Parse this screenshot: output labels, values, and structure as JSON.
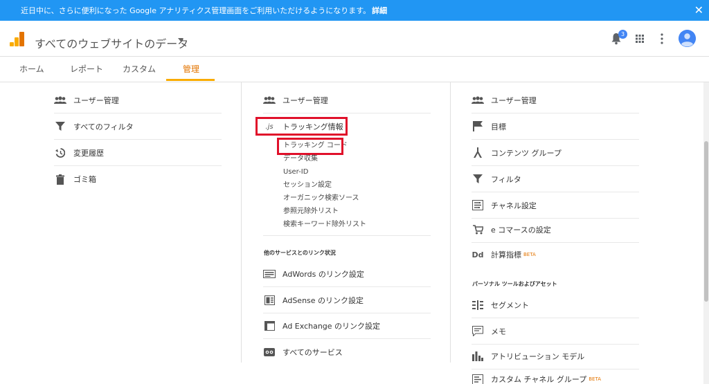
{
  "banner": {
    "text": "近日中に、さらに便利になった Google アナリティクス管理画面をご利用いただけるようになります。",
    "link": "詳細",
    "close": "✕"
  },
  "header": {
    "property_name": "すべてのウェブサイトのデータ",
    "notification_count": "3"
  },
  "tabs": [
    {
      "label": "ホーム"
    },
    {
      "label": "レポート"
    },
    {
      "label": "カスタム"
    },
    {
      "label": "管理"
    }
  ],
  "account_column": {
    "items": [
      {
        "label": "ユーザー管理",
        "icon": "users-icon"
      },
      {
        "label": "すべてのフィルタ",
        "icon": "filter-icon"
      },
      {
        "label": "変更履歴",
        "icon": "history-icon"
      },
      {
        "label": "ゴミ箱",
        "icon": "trash-icon"
      }
    ]
  },
  "property_column": {
    "user_mgmt": "ユーザー管理",
    "tracking_info": "トラッキング情報",
    "tracking_icon_text": ".js",
    "tracking_sub": [
      "トラッキング コード",
      "データ収集",
      "User-ID",
      "セッション設定",
      "オーガニック検索ソース",
      "参照元除外リスト",
      "検索キーワード除外リスト"
    ],
    "section_label": "他のサービスとのリンク状況",
    "links": [
      {
        "label": "AdWords のリンク設定",
        "icon": "adwords-icon"
      },
      {
        "label": "AdSense のリンク設定",
        "icon": "adsense-icon"
      },
      {
        "label": "Ad Exchange のリンク設定",
        "icon": "adexchange-icon"
      },
      {
        "label": "すべてのサービス",
        "icon": "link-icon"
      }
    ]
  },
  "view_column": {
    "items": [
      {
        "label": "ユーザー管理",
        "icon": "users-icon"
      },
      {
        "label": "目標",
        "icon": "flag-icon"
      },
      {
        "label": "コンテンツ グループ",
        "icon": "content-group-icon"
      },
      {
        "label": "フィルタ",
        "icon": "filter-icon"
      },
      {
        "label": "チャネル設定",
        "icon": "channel-icon"
      },
      {
        "label": "e コマースの設定",
        "icon": "cart-icon"
      },
      {
        "label": "計算指標",
        "icon": "dd-icon",
        "beta": "BETA"
      }
    ],
    "section_label": "パーソナル ツールおよびアセット",
    "tools": [
      {
        "label": "セグメント",
        "icon": "segment-icon"
      },
      {
        "label": "メモ",
        "icon": "memo-icon"
      },
      {
        "label": "アトリビューション モデル",
        "icon": "attribution-icon"
      },
      {
        "label": "カスタム チャネル グループ",
        "icon": "custom-channel-icon",
        "beta": "BETA"
      }
    ]
  },
  "colors": {
    "banner": "#2196f3",
    "accent": "#f9ab00",
    "active_tab": "#e37400",
    "highlight": "#e0102a"
  }
}
